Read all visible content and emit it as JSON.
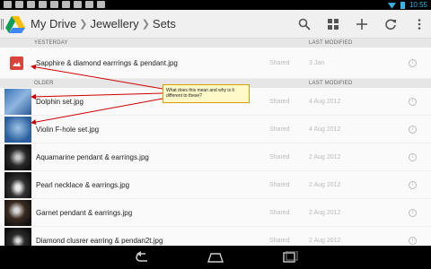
{
  "status_bar": {
    "time": "10:55"
  },
  "action_bar": {
    "breadcrumbs": [
      "My Drive",
      "Jewellery",
      "Sets"
    ],
    "actions": [
      {
        "name": "search-icon",
        "glyph": "search"
      },
      {
        "name": "grid-view-icon",
        "glyph": "grid"
      },
      {
        "name": "add-icon",
        "glyph": "+"
      },
      {
        "name": "refresh-icon",
        "glyph": "refresh"
      },
      {
        "name": "overflow-menu-icon",
        "glyph": "more"
      }
    ]
  },
  "list": {
    "yesterday": {
      "header": "YESTERDAY",
      "last_modified_header": "LAST MODIFIED",
      "rows": [
        {
          "name": "Sapphire & diamond earrrings & pendant.jpg",
          "status": "Shared",
          "date": "3 Jan"
        }
      ]
    },
    "older": {
      "header": "OLDER",
      "last_modified_header": "LAST MODIFIED",
      "rows": [
        {
          "name": "Dolphin set.jpg",
          "status": "Shared",
          "date": "4 Aug 2012"
        },
        {
          "name": "Violin F-hole set.jpg",
          "status": "Shared",
          "date": "4 Aug 2012"
        },
        {
          "name": "Aquamarine pendant & earrings.jpg",
          "status": "Shared",
          "date": "2 Aug 2012"
        },
        {
          "name": "Pearl necklace & earrings.jpg",
          "status": "Shared",
          "date": "2 Aug 2012"
        },
        {
          "name": "Garnet pendant & earrings.jpg",
          "status": "Shared",
          "date": "2 Aug 2012"
        },
        {
          "name": "Diamond clusrer earring & pendan2t.jpg",
          "status": "Shared",
          "date": "2 Aug 2012"
        }
      ]
    }
  },
  "callout": {
    "text": "What does this mean and why is it different to these?"
  },
  "colors": {
    "accent": "#33b5e5",
    "image_icon": "#d9453b",
    "callout_bg": "#fff8c8",
    "arrow": "#cc0000"
  }
}
